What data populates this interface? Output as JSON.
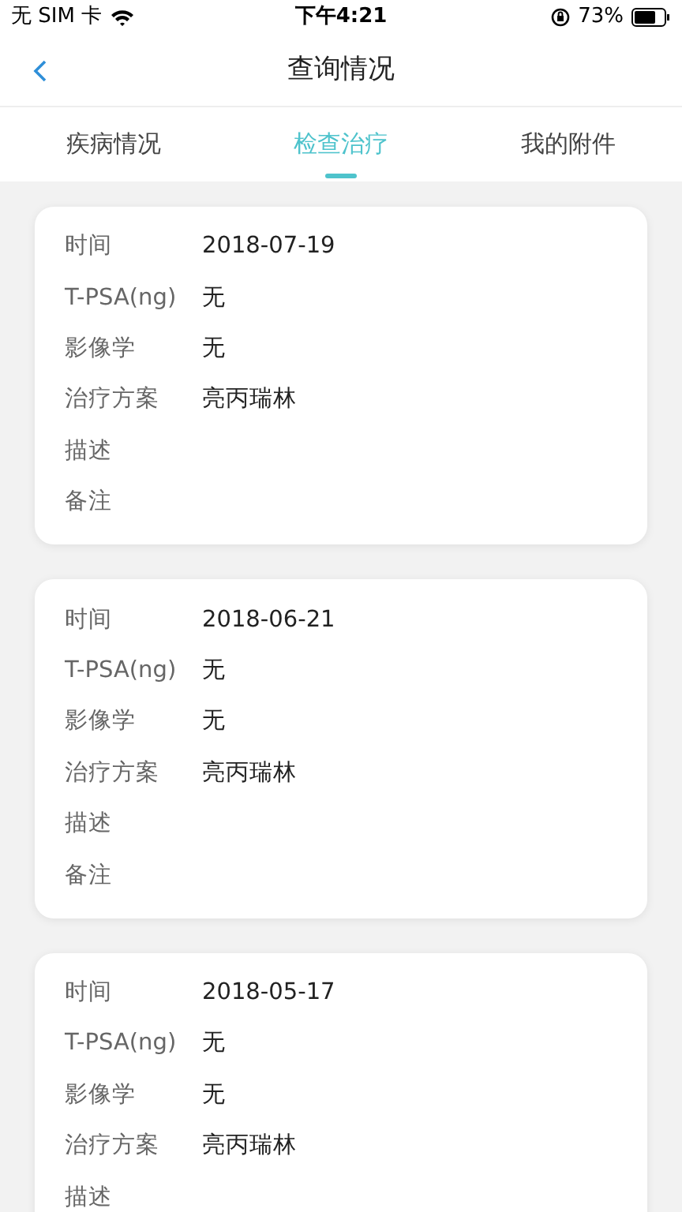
{
  "status_bar": {
    "carrier": "无 SIM 卡",
    "time": "下午4:21",
    "battery": "73%"
  },
  "nav": {
    "title": "查询情况"
  },
  "tabs": [
    {
      "label": "疾病情况",
      "selected": false
    },
    {
      "label": "检查治疗",
      "selected": true
    },
    {
      "label": "我的附件",
      "selected": false
    }
  ],
  "records": [
    {
      "fields": [
        {
          "label": "时间",
          "value": "2018-07-19"
        },
        {
          "label": "T-PSA(ng)",
          "value": "无"
        },
        {
          "label": "影像学",
          "value": "无"
        },
        {
          "label": "治疗方案",
          "value": "亮丙瑞林"
        },
        {
          "label": "描述"
        },
        {
          "label": "备注"
        }
      ]
    },
    {
      "fields": [
        {
          "label": "时间",
          "value": "2018-06-21"
        },
        {
          "label": "T-PSA(ng)",
          "value": "无"
        },
        {
          "label": "影像学",
          "value": "无"
        },
        {
          "label": "治疗方案",
          "value": "亮丙瑞林"
        },
        {
          "label": "描述"
        },
        {
          "label": "备注"
        }
      ]
    },
    {
      "fields": [
        {
          "label": "时间",
          "value": "2018-05-17"
        },
        {
          "label": "T-PSA(ng)",
          "value": "无"
        },
        {
          "label": "影像学",
          "value": "无"
        },
        {
          "label": "治疗方案",
          "value": "亮丙瑞林"
        },
        {
          "label": "描述"
        }
      ]
    }
  ]
}
